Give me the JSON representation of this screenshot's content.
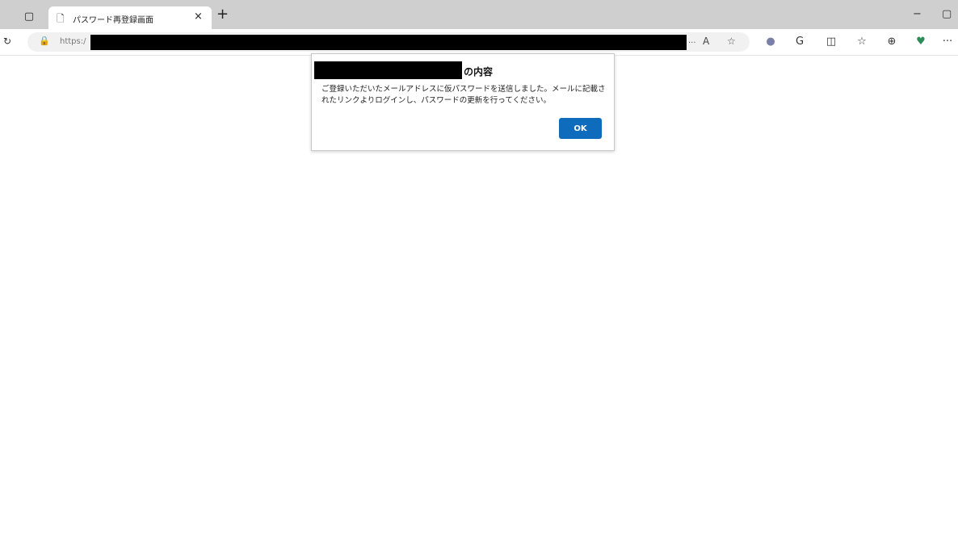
{
  "browser": {
    "tab": {
      "title": "パスワード再登録画面",
      "close_glyph": "×"
    },
    "new_tab_glyph": "+",
    "window_controls": {
      "minimize_glyph": "−",
      "maximize_glyph": "▢"
    },
    "address": {
      "url_prefix": "https:/",
      "ellipsis": "..."
    },
    "icons": {
      "sidebar": "▢",
      "page": "🗋",
      "reload": "↻",
      "lock": "🔒",
      "read_aloud": "A",
      "favorite": "☆",
      "extension_circle": "●",
      "refresh_c": "G",
      "split": "◫",
      "favorites": "☆",
      "collections": "⊕",
      "heart": "♥",
      "more": "···"
    }
  },
  "dialog": {
    "title_suffix": "の内容",
    "message": "ご登録いただいたメールアドレスに仮パスワードを送信しました。メールに記載されたリンクよりログインし、パスワードの更新を行ってください。",
    "ok_label": "OK"
  },
  "colors": {
    "tabbar_bg": "#cfcfcf",
    "ok_button": "#0f6cbd"
  }
}
